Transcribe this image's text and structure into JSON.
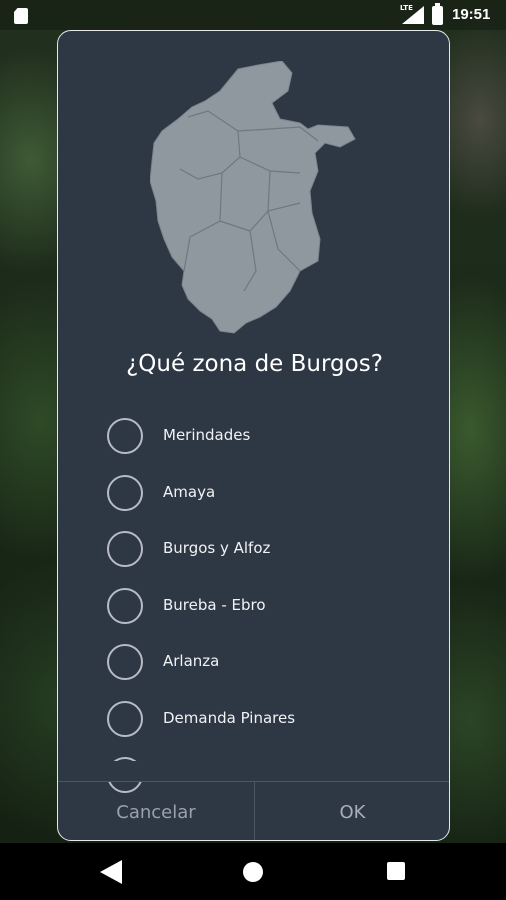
{
  "status_bar": {
    "time": "19:51",
    "network": "LTE",
    "icons": [
      "sim-card-icon",
      "signal-icon",
      "battery-charging-icon"
    ]
  },
  "dialog": {
    "title": "¿Qué zona de Burgos?",
    "map_icon": "burgos-province-map-icon",
    "options": [
      {
        "label": "Merindades",
        "selected": false
      },
      {
        "label": "Amaya",
        "selected": false
      },
      {
        "label": "Burgos y Alfoz",
        "selected": false
      },
      {
        "label": "Bureba - Ebro",
        "selected": false
      },
      {
        "label": "Arlanza",
        "selected": false
      },
      {
        "label": "Demanda Pinares",
        "selected": false
      }
    ],
    "cancel_label": "Cancelar",
    "ok_label": "OK"
  },
  "nav_bar": {
    "icons": [
      "back-icon",
      "home-icon",
      "recent-apps-icon"
    ]
  },
  "colors": {
    "dialog_bg": "#2e3744",
    "dialog_border": "#e6e8ec",
    "map_fill": "#8f979f",
    "button_text": "#9aa1ab"
  }
}
